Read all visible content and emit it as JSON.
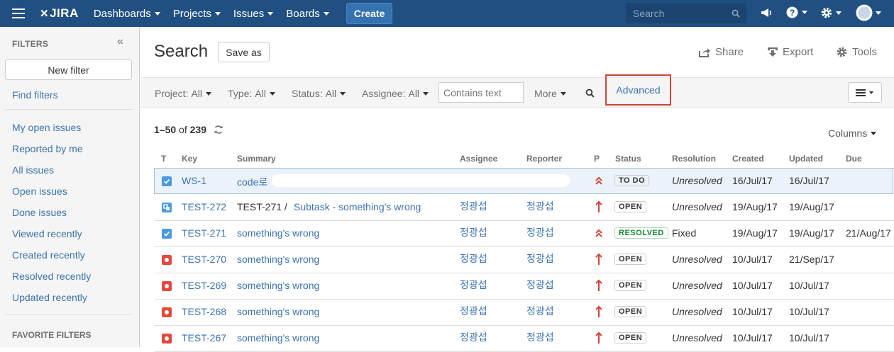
{
  "nav": {
    "logo": "JIRA",
    "items": [
      "Dashboards",
      "Projects",
      "Issues",
      "Boards"
    ],
    "create": "Create",
    "search_placeholder": "Search"
  },
  "sidebar": {
    "heading": "FILTERS",
    "collapse": "«",
    "new_filter": "New filter",
    "find_filters": "Find filters",
    "links": [
      "My open issues",
      "Reported by me",
      "All issues",
      "Open issues",
      "Done issues",
      "Viewed recently",
      "Created recently",
      "Resolved recently",
      "Updated recently"
    ],
    "favorites_heading": "FAVORITE FILTERS"
  },
  "header": {
    "title": "Search",
    "save_as": "Save as",
    "share": "Share",
    "export": "Export",
    "tools": "Tools"
  },
  "filters": {
    "project_label": "Project:",
    "project_value": "All",
    "type_label": "Type:",
    "type_value": "All",
    "status_label": "Status:",
    "status_value": "All",
    "assignee_label": "Assignee:",
    "assignee_value": "All",
    "contains_placeholder": "Contains text",
    "more": "More",
    "advanced": "Advanced"
  },
  "results": {
    "range": "1–50",
    "of": "of",
    "total": "239",
    "columns": "Columns"
  },
  "table": {
    "headers": [
      "T",
      "Key",
      "Summary",
      "Assignee",
      "Reporter",
      "P",
      "Status",
      "Resolution",
      "Created",
      "Updated",
      "Due"
    ],
    "rows": [
      {
        "type": "task",
        "key": "WS-1",
        "parent": "",
        "summary": "code로",
        "assignee": "",
        "reporter": "",
        "priority": "highest",
        "status": "TO DO",
        "resolution": "Unresolved",
        "created": "16/Jul/17",
        "updated": "16/Jul/17",
        "due": ""
      },
      {
        "type": "subtask",
        "key": "TEST-272",
        "parent": "TEST-271 /",
        "summary": "Subtask - something's wrong",
        "assignee": "정광섭",
        "reporter": "정광섭",
        "priority": "high",
        "status": "OPEN",
        "resolution": "Unresolved",
        "created": "19/Aug/17",
        "updated": "19/Aug/17",
        "due": ""
      },
      {
        "type": "task",
        "key": "TEST-271",
        "parent": "",
        "summary": "something's wrong",
        "assignee": "정광섭",
        "reporter": "정광섭",
        "priority": "highest",
        "status": "RESOLVED",
        "resolution": "Fixed",
        "created": "19/Aug/17",
        "updated": "19/Aug/17",
        "due": "21/Aug/17"
      },
      {
        "type": "bug",
        "key": "TEST-270",
        "parent": "",
        "summary": "something's wrong",
        "assignee": "정광섭",
        "reporter": "정광섭",
        "priority": "high",
        "status": "OPEN",
        "resolution": "Unresolved",
        "created": "10/Jul/17",
        "updated": "21/Sep/17",
        "due": ""
      },
      {
        "type": "bug",
        "key": "TEST-269",
        "parent": "",
        "summary": "something's wrong",
        "assignee": "정광섭",
        "reporter": "정광섭",
        "priority": "high",
        "status": "OPEN",
        "resolution": "Unresolved",
        "created": "10/Jul/17",
        "updated": "10/Jul/17",
        "due": ""
      },
      {
        "type": "bug",
        "key": "TEST-268",
        "parent": "",
        "summary": "something's wrong",
        "assignee": "정광섭",
        "reporter": "정광섭",
        "priority": "high",
        "status": "OPEN",
        "resolution": "Unresolved",
        "created": "10/Jul/17",
        "updated": "10/Jul/17",
        "due": ""
      },
      {
        "type": "bug",
        "key": "TEST-267",
        "parent": "",
        "summary": "something's wrong",
        "assignee": "정광섭",
        "reporter": "정광섭",
        "priority": "high",
        "status": "OPEN",
        "resolution": "Unresolved",
        "created": "10/Jul/17",
        "updated": "10/Jul/17",
        "due": ""
      }
    ]
  },
  "colors": {
    "nav_bg": "#205081",
    "link": "#3b73af",
    "task_icon": "#4a9ae1",
    "bug_icon": "#e5493a",
    "priority_red": "#d04437",
    "highlight_box": "#d04437",
    "resolved_green": "#14892c"
  },
  "icons": {
    "menu": "hamburger-icon",
    "search": "search-icon",
    "feedback": "megaphone-icon",
    "help": "help-icon",
    "settings": "gear-icon",
    "profile": "avatar-icon",
    "share": "share-icon",
    "export": "export-icon",
    "tools": "gear-icon",
    "refresh": "refresh-icon",
    "view": "list-view-icon"
  }
}
